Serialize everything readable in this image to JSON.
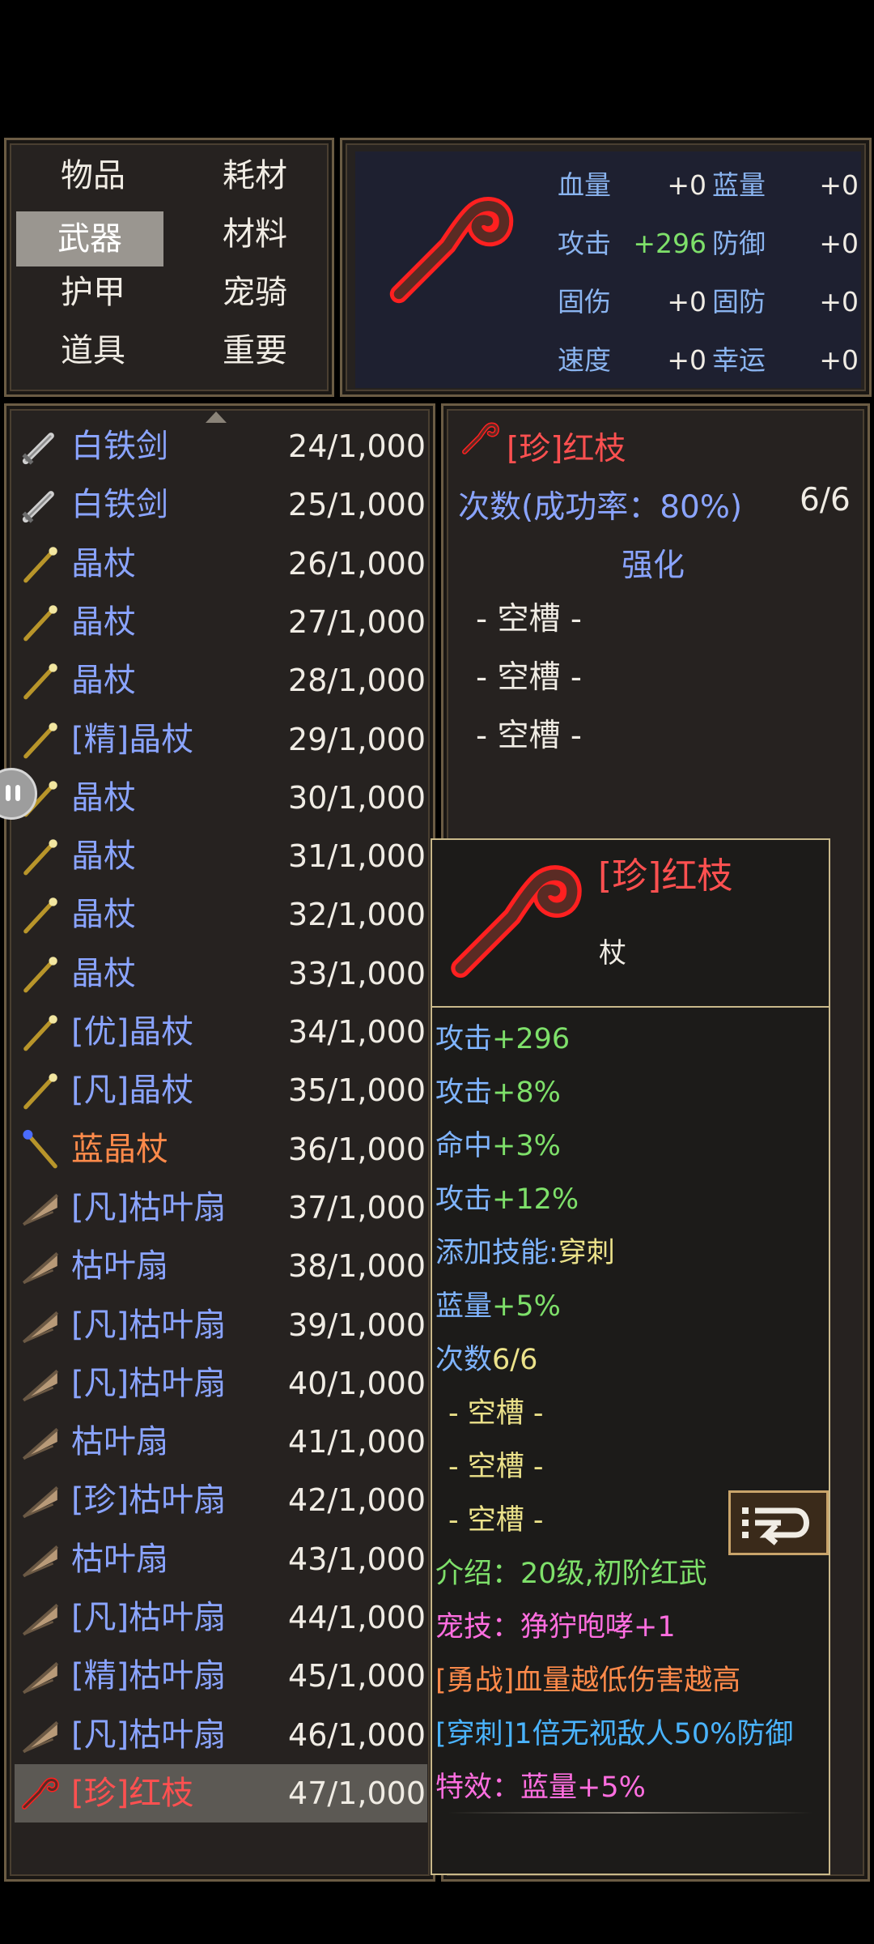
{
  "categories": {
    "items": [
      "物品",
      "耗材",
      "武器",
      "材料",
      "护甲",
      "宠骑",
      "道具",
      "重要"
    ],
    "selected": "武器"
  },
  "stats": {
    "hp_label": "血量",
    "hp_value": "+0",
    "mp_label": "蓝量",
    "mp_value": "+0",
    "atk_label": "攻击",
    "atk_value": "+296",
    "def_label": "防御",
    "def_value": "+0",
    "fixdmg_label": "固伤",
    "fixdmg_value": "+0",
    "fixdef_label": "固防",
    "fixdef_value": "+0",
    "spd_label": "速度",
    "spd_value": "+0",
    "luck_label": "幸运",
    "luck_value": "+0"
  },
  "inventory": [
    {
      "name": "白铁剑",
      "count": "24/1,000",
      "icon": "sword-icon"
    },
    {
      "name": "白铁剑",
      "count": "25/1,000",
      "icon": "sword-icon"
    },
    {
      "name": "晶杖",
      "count": "26/1,000",
      "icon": "staff-icon"
    },
    {
      "name": "晶杖",
      "count": "27/1,000",
      "icon": "staff-icon"
    },
    {
      "name": "晶杖",
      "count": "28/1,000",
      "icon": "staff-icon"
    },
    {
      "name": "[精]晶杖",
      "count": "29/1,000",
      "icon": "staff-icon"
    },
    {
      "name": "晶杖",
      "count": "30/1,000",
      "icon": "staff-icon"
    },
    {
      "name": "晶杖",
      "count": "31/1,000",
      "icon": "staff-icon"
    },
    {
      "name": "晶杖",
      "count": "32/1,000",
      "icon": "staff-icon"
    },
    {
      "name": "晶杖",
      "count": "33/1,000",
      "icon": "staff-icon"
    },
    {
      "name": "[优]晶杖",
      "count": "34/1,000",
      "icon": "staff-icon"
    },
    {
      "name": "[凡]晶杖",
      "count": "35/1,000",
      "icon": "staff-icon"
    },
    {
      "name": "蓝晶杖",
      "count": "36/1,000",
      "icon": "blue-staff-icon"
    },
    {
      "name": "[凡]枯叶扇",
      "count": "37/1,000",
      "icon": "fan-icon"
    },
    {
      "name": "枯叶扇",
      "count": "38/1,000",
      "icon": "fan-icon"
    },
    {
      "name": "[凡]枯叶扇",
      "count": "39/1,000",
      "icon": "fan-icon"
    },
    {
      "name": "[凡]枯叶扇",
      "count": "40/1,000",
      "icon": "fan-icon"
    },
    {
      "name": "枯叶扇",
      "count": "41/1,000",
      "icon": "fan-icon"
    },
    {
      "name": "[珍]枯叶扇",
      "count": "42/1,000",
      "icon": "fan-icon"
    },
    {
      "name": "枯叶扇",
      "count": "43/1,000",
      "icon": "fan-icon"
    },
    {
      "name": "[凡]枯叶扇",
      "count": "44/1,000",
      "icon": "fan-icon"
    },
    {
      "name": "[精]枯叶扇",
      "count": "45/1,000",
      "icon": "fan-icon"
    },
    {
      "name": "[凡]枯叶扇",
      "count": "46/1,000",
      "icon": "fan-icon"
    },
    {
      "name": "[珍]红枝",
      "count": "47/1,000",
      "icon": "red-branch-icon"
    }
  ],
  "detail": {
    "title": "[珍]红枝",
    "uses": "次数(成功率：80%)",
    "uses_count": "6/6",
    "enhance": "强化",
    "slots": [
      "- 空槽 -",
      "- 空槽 -",
      "- 空槽 -"
    ]
  },
  "tooltip": {
    "title": "[珍]红枝",
    "type": "杖",
    "lines": [
      {
        "label": "攻击",
        "value": "+296"
      },
      {
        "label": "攻击",
        "value": "+8%"
      },
      {
        "label": "命中",
        "value": "+3%"
      },
      {
        "label": "攻击",
        "value": "+12%"
      },
      {
        "label": "添加技能:",
        "value": "穿刺"
      },
      {
        "label": "蓝量",
        "value": "+5%"
      },
      {
        "label": "次数",
        "value": "6/6"
      }
    ],
    "slots": [
      "- 空槽 -",
      "- 空槽 -",
      "- 空槽 -"
    ],
    "intro": "介绍：20级,初阶红武",
    "pet_skill": "宠技：狰狞咆哮+1",
    "brave": "[勇战]血量越低伤害越高",
    "pierce": "[穿刺]1倍无视敌人50%防御",
    "effect_label": "特效：",
    "effect_value": "蓝量+5%"
  },
  "colors": {
    "normal_item": "#8aa4ff",
    "blue_item": "#ff8a4a",
    "rare_item": "#ff5050",
    "stat_label": "#8ab4f0",
    "bonus": "#7ee06a"
  }
}
